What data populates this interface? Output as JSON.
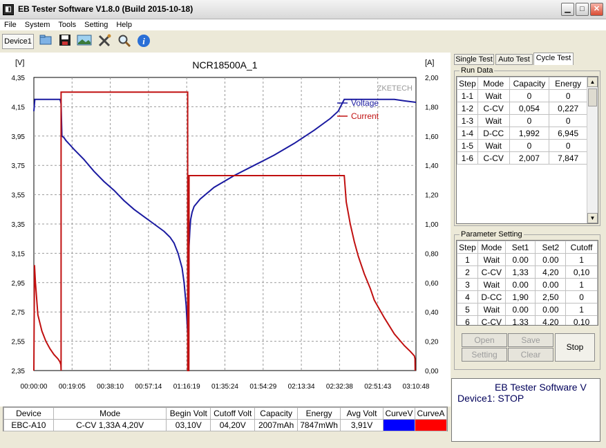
{
  "window": {
    "title": "EB Tester Software V1.8.0 (Build 2015-10-18)",
    "icon": "eb-app-icon"
  },
  "menu": [
    "File",
    "System",
    "Tools",
    "Setting",
    "Help"
  ],
  "toolbar": {
    "device_tab": "Device1",
    "icons": [
      "open-folder-icon",
      "save-icon",
      "picture-icon",
      "tools-icon",
      "zoom-icon",
      "info-icon"
    ]
  },
  "chart_data": {
    "type": "line",
    "title": "NCR18500A_1",
    "watermark": "ZKETECH",
    "ylabel_left": "[V]",
    "ylabel_right": "[A]",
    "ylim_left": [
      2.35,
      4.35
    ],
    "ylim_right": [
      0.0,
      2.0
    ],
    "left_ticks": [
      "4,35",
      "4,15",
      "3,95",
      "3,75",
      "3,55",
      "3,35",
      "3,15",
      "2,95",
      "2,75",
      "2,55",
      "2,35"
    ],
    "right_ticks": [
      "2,00",
      "1,80",
      "1,60",
      "1,40",
      "1,20",
      "1,00",
      "0,80",
      "0,60",
      "0,40",
      "0,20",
      "0,00"
    ],
    "x_ticks": [
      "00:00:00",
      "00:19:05",
      "00:38:10",
      "00:57:14",
      "01:16:19",
      "01:35:24",
      "01:54:29",
      "02:13:34",
      "02:32:38",
      "02:51:43",
      "03:10:48"
    ],
    "x_range_minutes": [
      0,
      190.8
    ],
    "grid": true,
    "legend_position": "top-right",
    "series": [
      {
        "name": "Voltage",
        "axis": "left",
        "color": "#1a1aa0",
        "x_minutes": [
          0,
          0.5,
          13,
          13.3,
          13.6,
          14,
          15,
          16,
          18,
          20,
          25,
          30,
          35,
          40,
          45,
          50,
          55,
          60,
          65,
          68,
          70,
          72,
          74,
          75,
          76,
          76.8,
          77.2,
          77.5,
          77.9,
          78.3,
          79,
          80,
          83,
          90,
          100,
          110,
          120,
          130,
          140,
          148,
          152,
          155,
          160,
          170,
          180,
          185,
          190.8
        ],
        "values": [
          4.12,
          4.2,
          4.2,
          4.19,
          4.17,
          3.95,
          3.94,
          3.92,
          3.89,
          3.86,
          3.79,
          3.71,
          3.64,
          3.58,
          3.51,
          3.45,
          3.4,
          3.35,
          3.3,
          3.26,
          3.22,
          3.15,
          3.05,
          2.95,
          2.8,
          2.6,
          2.52,
          3.2,
          3.31,
          3.38,
          3.43,
          3.47,
          3.52,
          3.6,
          3.68,
          3.75,
          3.82,
          3.9,
          3.99,
          4.07,
          4.12,
          4.2,
          4.2,
          4.2,
          4.2,
          4.19,
          4.18
        ]
      },
      {
        "name": "Current",
        "axis": "right",
        "color": "#c01010",
        "x_minutes": [
          0,
          0.3,
          0.8,
          2,
          4,
          6,
          8,
          10,
          12,
          13,
          13.5,
          13.6,
          13.6,
          76.8,
          76.8,
          77.4,
          77.5,
          77.5,
          155,
          156,
          158,
          160,
          162,
          165,
          168,
          170,
          175,
          180,
          185,
          188,
          190,
          190.3,
          190.4
        ],
        "values": [
          0.0,
          0.72,
          0.6,
          0.38,
          0.27,
          0.2,
          0.15,
          0.11,
          0.08,
          0.06,
          0.04,
          0.0,
          1.9,
          1.9,
          0.0,
          0.0,
          1.33,
          1.33,
          1.33,
          1.15,
          1.0,
          0.88,
          0.78,
          0.66,
          0.56,
          0.48,
          0.36,
          0.25,
          0.17,
          0.13,
          0.1,
          0.08,
          0.0
        ]
      }
    ]
  },
  "summary_table": {
    "headers": [
      "Device",
      "Mode",
      "Begin Volt",
      "Cutoff Volt",
      "Capacity",
      "Energy",
      "Avg Volt",
      "CurveV",
      "CurveA"
    ],
    "row": [
      "EBC-A10",
      "C-CV  1,33A  4,20V",
      "03,10V",
      "04,20V",
      "2007mAh",
      "7847mWh",
      "3,91V"
    ],
    "curve_colors": [
      "#0000ff",
      "#ff0000"
    ]
  },
  "right_panel": {
    "tabs": [
      "Single Test",
      "Auto Test",
      "Cycle Test"
    ],
    "active_tab": "Cycle Test",
    "run_data": {
      "label": "Run Data",
      "headers": [
        "Step",
        "Mode",
        "Capacity",
        "Energy"
      ],
      "rows": [
        [
          "1-1",
          "Wait",
          "0",
          "0"
        ],
        [
          "1-2",
          "C-CV",
          "0,054",
          "0,227"
        ],
        [
          "1-3",
          "Wait",
          "0",
          "0"
        ],
        [
          "1-4",
          "D-CC",
          "1,992",
          "6,945"
        ],
        [
          "1-5",
          "Wait",
          "0",
          "0"
        ],
        [
          "1-6",
          "C-CV",
          "2,007",
          "7,847"
        ]
      ]
    },
    "params": {
      "label": "Parameter Setting",
      "headers": [
        "Step",
        "Mode",
        "Set1",
        "Set2",
        "Cutoff"
      ],
      "rows": [
        [
          "1",
          "Wait",
          "0.00",
          "0.00",
          "1"
        ],
        [
          "2",
          "C-CV",
          "1,33",
          "4,20",
          "0,10"
        ],
        [
          "3",
          "Wait",
          "0.00",
          "0.00",
          "1"
        ],
        [
          "4",
          "D-CC",
          "1,90",
          "2,50",
          "0"
        ],
        [
          "5",
          "Wait",
          "0.00",
          "0.00",
          "1"
        ],
        [
          "6",
          "C-CV",
          "1,33",
          "4,20",
          "0,10"
        ]
      ]
    },
    "buttons": {
      "open": "Open",
      "save": "Save",
      "setting": "Setting",
      "clear": "Clear",
      "stop": "Stop"
    },
    "status": {
      "line1": "EB Tester Software V",
      "line2": "Device1: STOP"
    }
  }
}
